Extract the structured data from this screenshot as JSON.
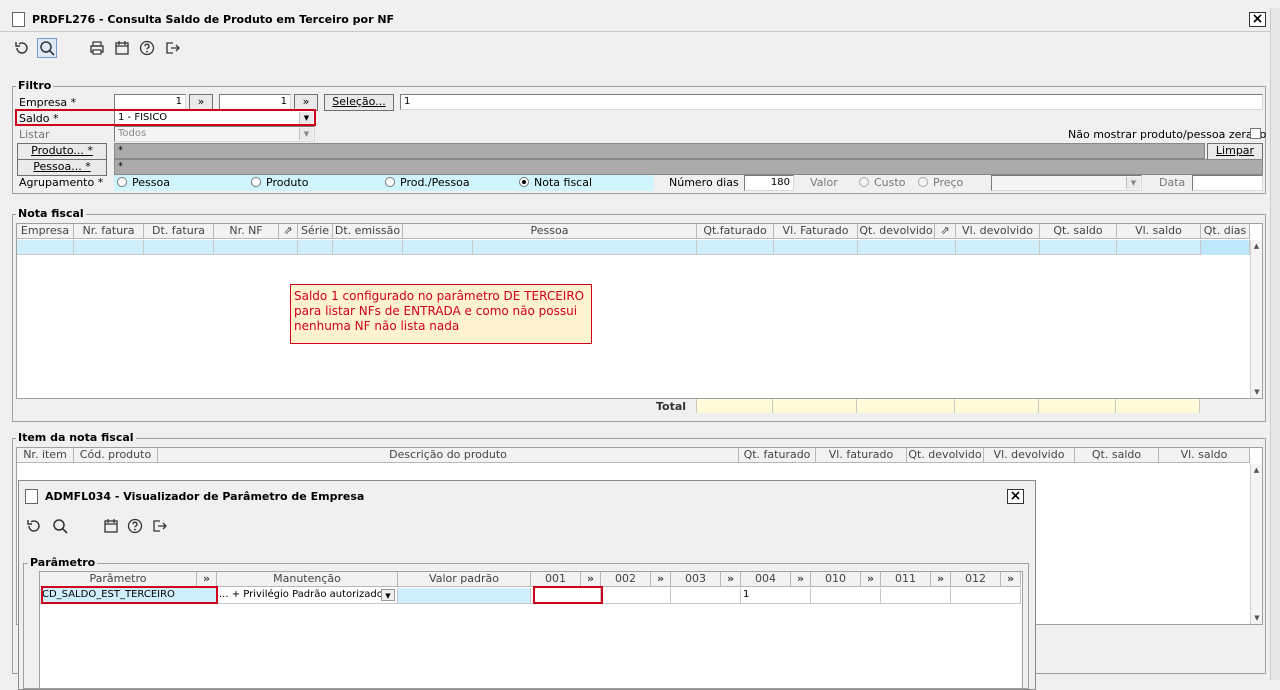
{
  "window": {
    "title": "PRDFL276 - Consulta Saldo de Produto em Terceiro por NF",
    "close": "×"
  },
  "toolbar": {
    "icons": [
      "refresh-icon",
      "search-icon",
      "print-icon",
      "calendar-icon",
      "help-icon",
      "exit-icon"
    ]
  },
  "filtro": {
    "title": "Filtro",
    "empresa_label": "Empresa *",
    "empresa_from": "1",
    "empresa_to": "1",
    "arrow": "»",
    "selecao_label": "Seleção...",
    "selecao_value": "1",
    "saldo_label": "Saldo *",
    "saldo_value": "1 - FISICO",
    "listar_label": "Listar",
    "listar_value": "Todos",
    "nao_mostrar_label": "Não mostrar produto/pessoa zerado",
    "produto_button": "Produto... *",
    "produto_value": "*",
    "limpar_button": "Limpar",
    "pessoa_button": "Pessoa... *",
    "pessoa_value": "*",
    "agrupamento_label": "Agrupamento *",
    "agrupamento_options": [
      "Pessoa",
      "Produto",
      "Prod./Pessoa",
      "Nota fiscal"
    ],
    "agrupamento_selected": "Nota fiscal",
    "numero_dias_label": "Número dias",
    "numero_dias_value": "180",
    "valor_label": "Valor",
    "valor_options": [
      "Custo",
      "Preço"
    ],
    "data_label": "Data"
  },
  "nota_fiscal": {
    "title": "Nota fiscal",
    "columns": [
      "Empresa",
      "Nr. fatura",
      "Dt. fatura",
      "Nr. NF",
      "⇗",
      "Série",
      "Dt. emissão",
      "Pessoa",
      "Qt.faturado",
      "Vl. Faturado",
      "Qt. devolvido",
      "⇗",
      "Vl. devolvido",
      "Qt. saldo",
      "Vl. saldo",
      "Qt. dias"
    ],
    "total_label": "Total"
  },
  "note": "Saldo 1 configurado no parâmetro DE TERCEIRO para listar NFs de ENTRADA e como não possui nenhuma NF não lista nada",
  "item_nota": {
    "title": "Item da nota fiscal",
    "columns": [
      "Nr. item",
      "Cód. produto",
      "Descrição do produto",
      "Qt. faturado",
      "Vl. faturado",
      "Qt. devolvido",
      "Vl. devolvido",
      "Qt. saldo",
      "Vl. saldo"
    ]
  },
  "popup": {
    "title": "ADMFL034 - Visualizador de Parâmetro de Empresa",
    "close": "×",
    "toolbar_icons": [
      "refresh-icon",
      "search-icon",
      "calendar-icon",
      "help-icon",
      "exit-icon"
    ],
    "group_title": "Parâmetro",
    "columns": [
      "Parâmetro",
      "»",
      "Manutenção",
      "Valor padrão",
      "001",
      "»",
      "002",
      "»",
      "003",
      "»",
      "004",
      "»",
      "010",
      "»",
      "011",
      "»",
      "012",
      "»"
    ],
    "row": {
      "parametro": "CD_SALDO_EST_TERCEIRO",
      "manutencao": "... + Privilégio Padrão autorizado",
      "valor_padrao": "",
      "v001": "",
      "v002": "",
      "v003": "",
      "v004": "1",
      "v010": "",
      "v011": "",
      "v012": ""
    }
  }
}
